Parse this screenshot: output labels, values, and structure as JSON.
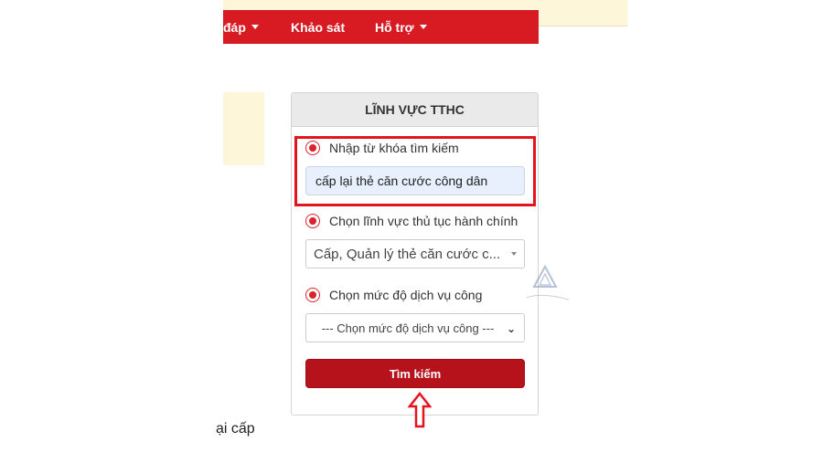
{
  "navbar": {
    "items": [
      {
        "label": "đáp",
        "has_caret": true
      },
      {
        "label": "Khảo sát",
        "has_caret": false
      },
      {
        "label": "Hỗ trợ",
        "has_caret": true
      }
    ]
  },
  "panel": {
    "title": "LĨNH VỰC TTHC",
    "options": [
      {
        "label": "Nhập từ khóa tìm kiếm",
        "selected": true
      },
      {
        "label": "Chọn lĩnh vực thủ tục hành chính",
        "selected": true
      },
      {
        "label": "Chọn mức độ dịch vụ công",
        "selected": true
      }
    ],
    "keyword_input": {
      "value": "cấp lại thẻ căn cước công dân"
    },
    "field_select": {
      "value": "Cấp, Quản lý thẻ căn cước c..."
    },
    "level_select": {
      "value": "--- Chọn mức độ dịch vụ công ---"
    },
    "search_button": "Tìm kiếm"
  },
  "background_text": "ại cấp",
  "colors": {
    "brand_red": "#d81b23",
    "button_red": "#b5121b",
    "highlight_red": "#e4141e",
    "input_bg": "#e8f0fe",
    "band_yellow": "#fdf6d8"
  },
  "icons": {
    "caret": "caret-down-icon",
    "arrow": "arrow-up-icon",
    "watermark": "watermark-logo"
  }
}
